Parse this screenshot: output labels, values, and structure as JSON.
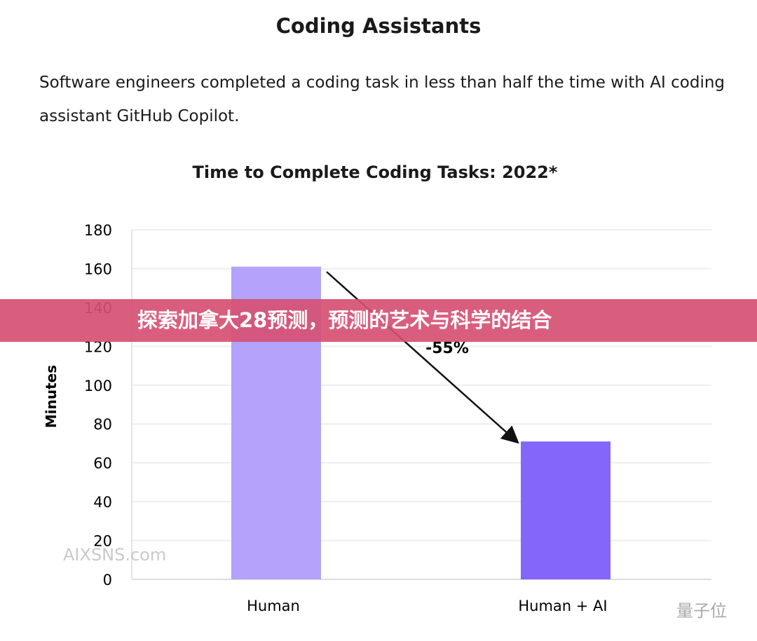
{
  "heading": "Coding Assistants",
  "description": "Software engineers completed a coding task in less than half the time with AI coding assistant GitHub Copilot.",
  "banner": "探索加拿大28预测，预测的艺术与科学的结合",
  "watermarks": {
    "left": "AIXSNS.com",
    "right": "量子位"
  },
  "chart_data": {
    "type": "bar",
    "title": "Time to Complete Coding Tasks: 2022*",
    "xlabel": "",
    "ylabel": "Minutes",
    "categories": [
      "Human",
      "Human + AI"
    ],
    "values": [
      161,
      71
    ],
    "colors": [
      "#b4a2fb",
      "#8466fb"
    ],
    "ylim": [
      0,
      180
    ],
    "yticks": [
      0,
      20,
      40,
      60,
      80,
      100,
      120,
      140,
      160,
      180
    ],
    "grid": true,
    "annotation": "-55%"
  }
}
